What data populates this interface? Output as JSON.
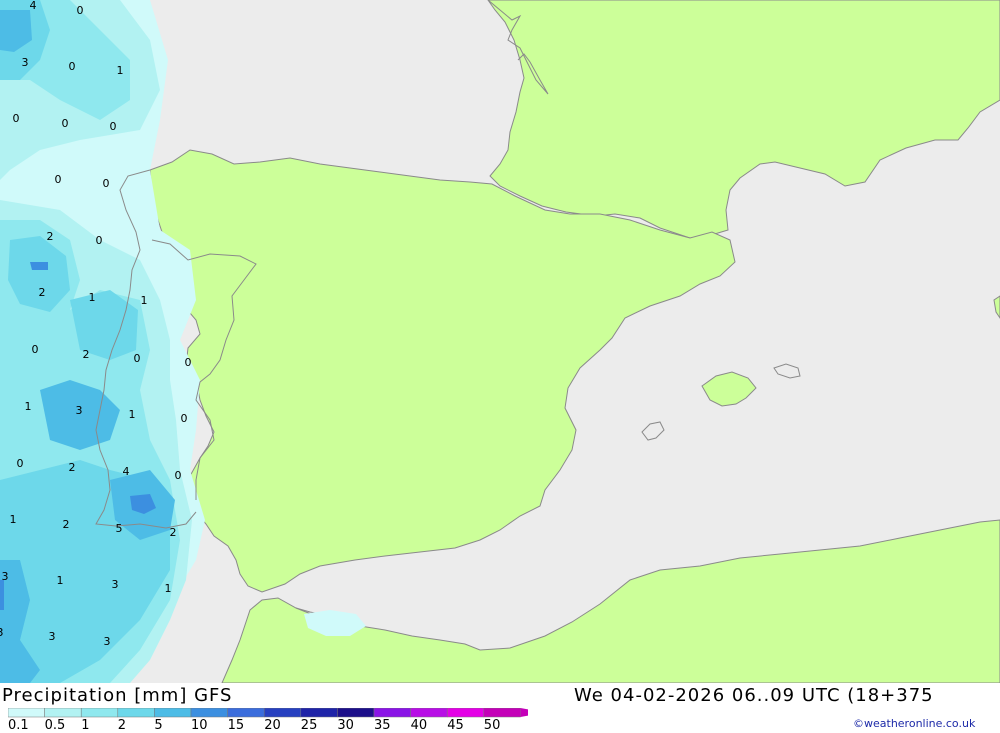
{
  "map": {
    "title": "Precipitation [mm] GFS",
    "valid_time": "We 04-02-2026 06..09 UTC (18+375",
    "credit": "©weatheronline.co.uk",
    "colors": {
      "sea": "#ececec",
      "land": "#ccff99",
      "coast": "#8a8a8a"
    },
    "legend": {
      "labels": [
        "0.1",
        "0.5",
        "1",
        "2",
        "5",
        "10",
        "15",
        "20",
        "25",
        "30",
        "35",
        "40",
        "45",
        "50"
      ],
      "colors": [
        "#d0fafa",
        "#b2f2f2",
        "#8fe8ee",
        "#6dd8ea",
        "#4dbce6",
        "#3c8fe0",
        "#3b6ddc",
        "#2740c0",
        "#1f24a8",
        "#1c0f8a",
        "#8a14e6",
        "#b80ee6",
        "#e400e6",
        "#c400b8"
      ]
    },
    "point_values": [
      {
        "v": "4"
      },
      {
        "v": "0"
      },
      {
        "v": "3"
      },
      {
        "v": "0"
      },
      {
        "v": "1"
      },
      {
        "v": "0"
      },
      {
        "v": "0"
      },
      {
        "v": "0"
      },
      {
        "v": "0"
      },
      {
        "v": "0"
      },
      {
        "v": "2"
      },
      {
        "v": "0"
      },
      {
        "v": "2"
      },
      {
        "v": "1"
      },
      {
        "v": "1"
      },
      {
        "v": "0"
      },
      {
        "v": "2"
      },
      {
        "v": "0"
      },
      {
        "v": "0"
      },
      {
        "v": "1"
      },
      {
        "v": "3"
      },
      {
        "v": "1"
      },
      {
        "v": "0"
      },
      {
        "v": "0"
      },
      {
        "v": "2"
      },
      {
        "v": "4"
      },
      {
        "v": "0"
      },
      {
        "v": "1"
      },
      {
        "v": "2"
      },
      {
        "v": "5"
      },
      {
        "v": "2"
      },
      {
        "v": "3"
      },
      {
        "v": "1"
      },
      {
        "v": "3"
      },
      {
        "v": "1"
      },
      {
        "v": "3"
      },
      {
        "v": "3"
      },
      {
        "v": "3"
      }
    ]
  }
}
